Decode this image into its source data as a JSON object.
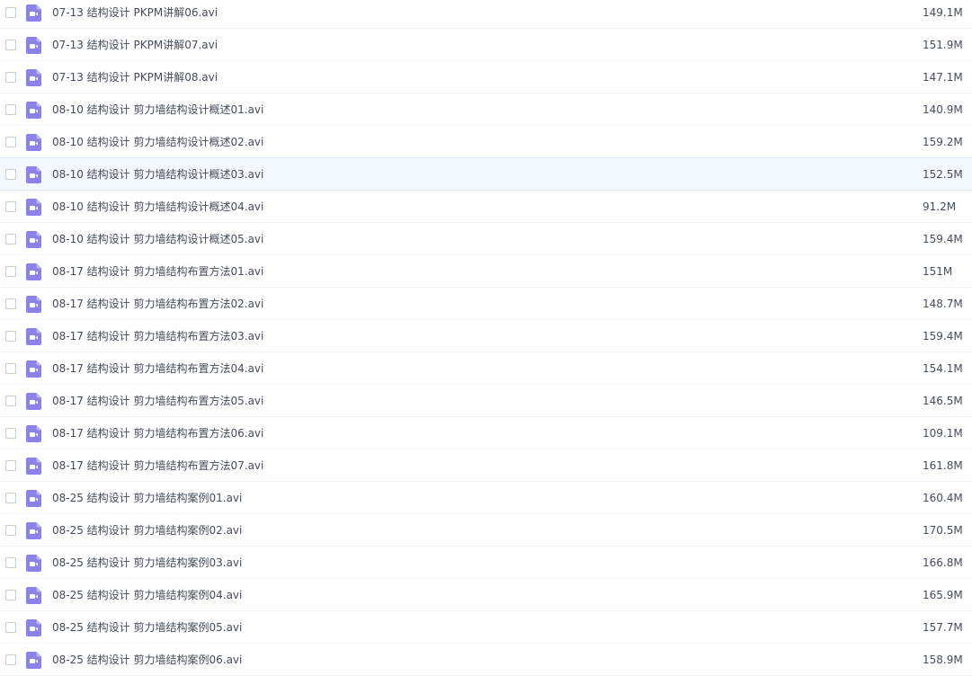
{
  "colors": {
    "video_icon": "#8b82ec",
    "text": "#454d5a",
    "row_hover": "#f4f9ff",
    "divider": "#f1f2f4"
  },
  "file_list": {
    "icon": "video-file-icon",
    "hovered_index": 5,
    "rows": [
      {
        "name": "07-13 结构设计 PKPM讲解06.avi",
        "size": "149.1M"
      },
      {
        "name": "07-13 结构设计 PKPM讲解07.avi",
        "size": "151.9M"
      },
      {
        "name": "07-13 结构设计 PKPM讲解08.avi",
        "size": "147.1M"
      },
      {
        "name": "08-10 结构设计 剪力墙结构设计概述01.avi",
        "size": "140.9M"
      },
      {
        "name": "08-10 结构设计 剪力墙结构设计概述02.avi",
        "size": "159.2M"
      },
      {
        "name": "08-10 结构设计 剪力墙结构设计概述03.avi",
        "size": "152.5M"
      },
      {
        "name": "08-10 结构设计 剪力墙结构设计概述04.avi",
        "size": "91.2M"
      },
      {
        "name": "08-10 结构设计 剪力墙结构设计概述05.avi",
        "size": "159.4M"
      },
      {
        "name": "08-17 结构设计 剪力墙结构布置方法01.avi",
        "size": "151M"
      },
      {
        "name": "08-17 结构设计 剪力墙结构布置方法02.avi",
        "size": "148.7M"
      },
      {
        "name": "08-17 结构设计 剪力墙结构布置方法03.avi",
        "size": "159.4M"
      },
      {
        "name": "08-17 结构设计 剪力墙结构布置方法04.avi",
        "size": "154.1M"
      },
      {
        "name": "08-17 结构设计 剪力墙结构布置方法05.avi",
        "size": "146.5M"
      },
      {
        "name": "08-17 结构设计 剪力墙结构布置方法06.avi",
        "size": "109.1M"
      },
      {
        "name": "08-17 结构设计 剪力墙结构布置方法07.avi",
        "size": "161.8M"
      },
      {
        "name": "08-25 结构设计 剪力墙结构案例01.avi",
        "size": "160.4M"
      },
      {
        "name": "08-25 结构设计 剪力墙结构案例02.avi",
        "size": "170.5M"
      },
      {
        "name": "08-25 结构设计 剪力墙结构案例03.avi",
        "size": "166.8M"
      },
      {
        "name": "08-25 结构设计 剪力墙结构案例04.avi",
        "size": "165.9M"
      },
      {
        "name": "08-25 结构设计 剪力墙结构案例05.avi",
        "size": "157.7M"
      },
      {
        "name": "08-25 结构设计 剪力墙结构案例06.avi",
        "size": "158.9M"
      }
    ]
  }
}
